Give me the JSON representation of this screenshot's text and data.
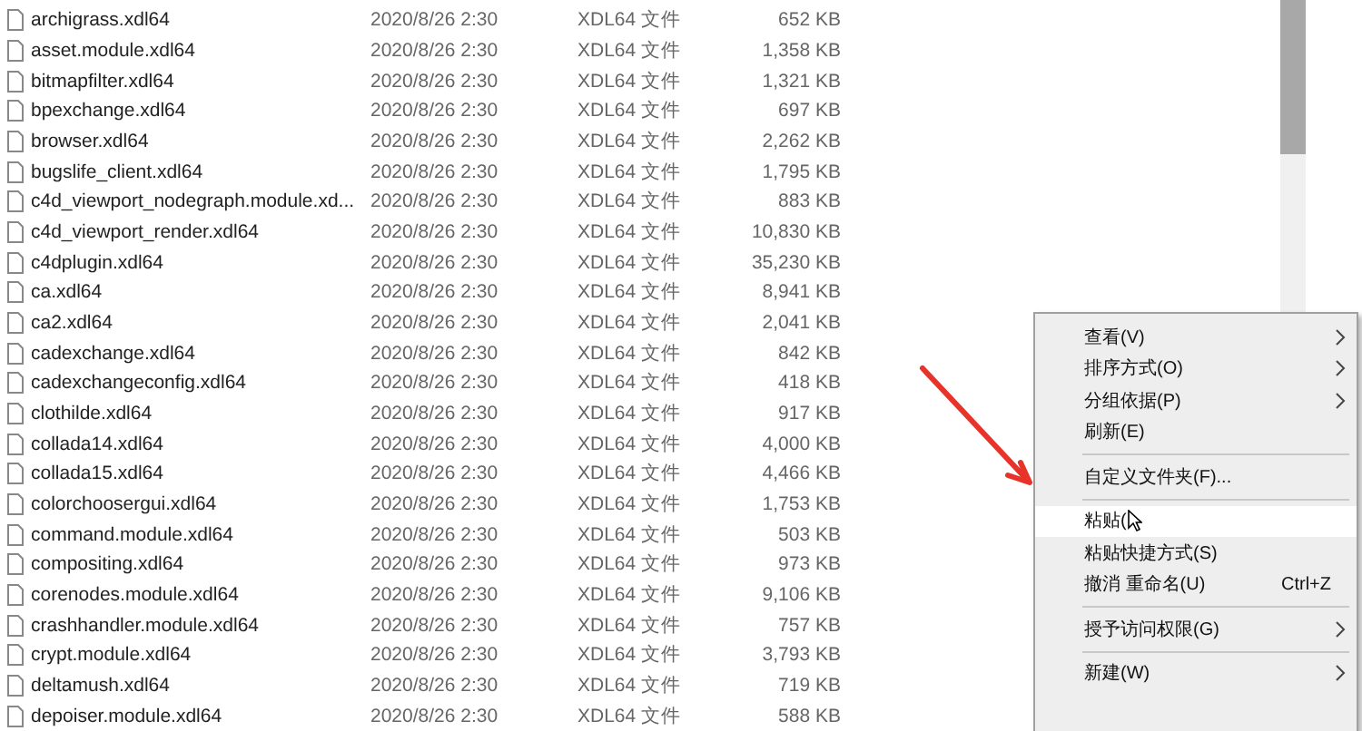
{
  "files": [
    {
      "name": "archigrass.xdl64",
      "date": "2020/8/26 2:30",
      "type": "XDL64 文件",
      "size": "652 KB"
    },
    {
      "name": "asset.module.xdl64",
      "date": "2020/8/26 2:30",
      "type": "XDL64 文件",
      "size": "1,358 KB"
    },
    {
      "name": "bitmapfilter.xdl64",
      "date": "2020/8/26 2:30",
      "type": "XDL64 文件",
      "size": "1,321 KB"
    },
    {
      "name": "bpexchange.xdl64",
      "date": "2020/8/26 2:30",
      "type": "XDL64 文件",
      "size": "697 KB"
    },
    {
      "name": "browser.xdl64",
      "date": "2020/8/26 2:30",
      "type": "XDL64 文件",
      "size": "2,262 KB"
    },
    {
      "name": "bugslife_client.xdl64",
      "date": "2020/8/26 2:30",
      "type": "XDL64 文件",
      "size": "1,795 KB"
    },
    {
      "name": "c4d_viewport_nodegraph.module.xd...",
      "date": "2020/8/26 2:30",
      "type": "XDL64 文件",
      "size": "883 KB"
    },
    {
      "name": "c4d_viewport_render.xdl64",
      "date": "2020/8/26 2:30",
      "type": "XDL64 文件",
      "size": "10,830 KB"
    },
    {
      "name": "c4dplugin.xdl64",
      "date": "2020/8/26 2:30",
      "type": "XDL64 文件",
      "size": "35,230 KB"
    },
    {
      "name": "ca.xdl64",
      "date": "2020/8/26 2:30",
      "type": "XDL64 文件",
      "size": "8,941 KB"
    },
    {
      "name": "ca2.xdl64",
      "date": "2020/8/26 2:30",
      "type": "XDL64 文件",
      "size": "2,041 KB"
    },
    {
      "name": "cadexchange.xdl64",
      "date": "2020/8/26 2:30",
      "type": "XDL64 文件",
      "size": "842 KB"
    },
    {
      "name": "cadexchangeconfig.xdl64",
      "date": "2020/8/26 2:30",
      "type": "XDL64 文件",
      "size": "418 KB"
    },
    {
      "name": "clothilde.xdl64",
      "date": "2020/8/26 2:30",
      "type": "XDL64 文件",
      "size": "917 KB"
    },
    {
      "name": "collada14.xdl64",
      "date": "2020/8/26 2:30",
      "type": "XDL64 文件",
      "size": "4,000 KB"
    },
    {
      "name": "collada15.xdl64",
      "date": "2020/8/26 2:30",
      "type": "XDL64 文件",
      "size": "4,466 KB"
    },
    {
      "name": "colorchoosergui.xdl64",
      "date": "2020/8/26 2:30",
      "type": "XDL64 文件",
      "size": "1,753 KB"
    },
    {
      "name": "command.module.xdl64",
      "date": "2020/8/26 2:30",
      "type": "XDL64 文件",
      "size": "503 KB"
    },
    {
      "name": "compositing.xdl64",
      "date": "2020/8/26 2:30",
      "type": "XDL64 文件",
      "size": "973 KB"
    },
    {
      "name": "corenodes.module.xdl64",
      "date": "2020/8/26 2:30",
      "type": "XDL64 文件",
      "size": "9,106 KB"
    },
    {
      "name": "crashhandler.module.xdl64",
      "date": "2020/8/26 2:30",
      "type": "XDL64 文件",
      "size": "757 KB"
    },
    {
      "name": "crypt.module.xdl64",
      "date": "2020/8/26 2:30",
      "type": "XDL64 文件",
      "size": "3,793 KB"
    },
    {
      "name": "deltamush.xdl64",
      "date": "2020/8/26 2:30",
      "type": "XDL64 文件",
      "size": "719 KB"
    },
    {
      "name": "depoiser.module.xdl64",
      "date": "2020/8/26 2:30",
      "type": "XDL64 文件",
      "size": "588 KB"
    }
  ],
  "context_menu": [
    {
      "kind": "item",
      "label": "查看(V)",
      "submenu": true,
      "selected": false
    },
    {
      "kind": "item",
      "label": "排序方式(O)",
      "submenu": true,
      "selected": false
    },
    {
      "kind": "item",
      "label": "分组依据(P)",
      "submenu": true,
      "selected": false
    },
    {
      "kind": "item",
      "label": "刷新(E)",
      "submenu": false,
      "selected": false
    },
    {
      "kind": "separator"
    },
    {
      "kind": "item",
      "label": "自定义文件夹(F)...",
      "submenu": false,
      "selected": false
    },
    {
      "kind": "separator"
    },
    {
      "kind": "item",
      "label": "粘贴(",
      "submenu": false,
      "selected": true
    },
    {
      "kind": "item",
      "label": "粘贴快捷方式(S)",
      "submenu": false,
      "selected": false
    },
    {
      "kind": "item",
      "label": "撤消 重命名(U)",
      "shortcut": "Ctrl+Z",
      "submenu": false,
      "selected": false
    },
    {
      "kind": "separator"
    },
    {
      "kind": "item",
      "label": "授予访问权限(G)",
      "submenu": true,
      "selected": false
    },
    {
      "kind": "separator"
    },
    {
      "kind": "item",
      "label": "新建(W)",
      "submenu": true,
      "selected": false
    }
  ]
}
